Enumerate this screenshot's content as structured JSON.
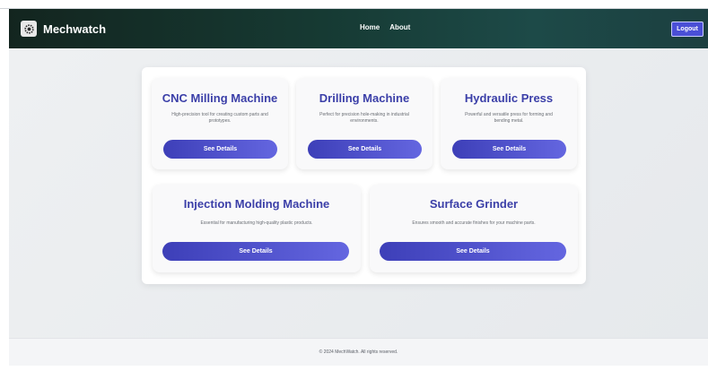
{
  "app": {
    "brand_name": "Mechwatch",
    "logo_icon": "gear-icon"
  },
  "nav": {
    "links": [
      "Home",
      "About"
    ],
    "logout_label": "Logout"
  },
  "cards": [
    {
      "title": "CNC Milling Machine",
      "description": "High-precision tool for creating custom parts and prototypes.",
      "button_label": "See Details"
    },
    {
      "title": "Drilling Machine",
      "description": "Perfect for precision hole-making in industrial environments.",
      "button_label": "See Details"
    },
    {
      "title": "Hydraulic Press",
      "description": "Powerful and versatile press for forming and bending metal.",
      "button_label": "See Details"
    },
    {
      "title": "Injection Molding Machine",
      "description": "Essential for manufacturing high-quality plastic products.",
      "button_label": "See Details"
    },
    {
      "title": "Surface Grinder",
      "description": "Ensures smooth and accurate finishes for your machine parts.",
      "button_label": "See Details"
    }
  ],
  "footer": {
    "text": "© 2024 MechWatch. All rights reserved."
  },
  "colors": {
    "navbar": "#163a33",
    "accent": "#4a4fd6",
    "card_title": "#3b3fa8"
  }
}
